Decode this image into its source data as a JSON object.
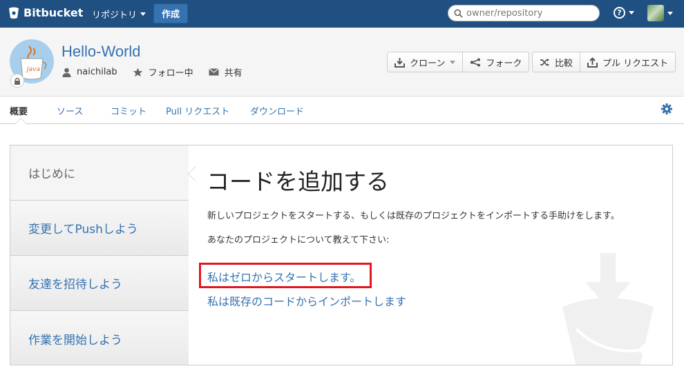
{
  "topbar": {
    "brand": "Bitbucket",
    "repositories_label": "リポジトリ",
    "create_label": "作成",
    "search_placeholder": "owner/repository",
    "help_icon_text": "?"
  },
  "repo": {
    "name": "Hello-World",
    "owner": "naichilab",
    "following_label": "フォロー中",
    "share_label": "共有",
    "avatar_text": "Java",
    "actions": {
      "clone_label": "クローン",
      "fork_label": "フォーク",
      "compare_label": "比較",
      "pull_request_label": "プル リクエスト"
    }
  },
  "tabs": [
    {
      "label": "概要"
    },
    {
      "label": "ソース"
    },
    {
      "label": "コミット"
    },
    {
      "label": "Pull リクエスト"
    },
    {
      "label": "ダウンロード"
    }
  ],
  "steps": [
    {
      "label": "はじめに"
    },
    {
      "label": "変更してPushしよう"
    },
    {
      "label": "友達を招待しよう"
    },
    {
      "label": "作業を開始しよう"
    }
  ],
  "main": {
    "heading": "コードを追加する",
    "description": "新しいプロジェクトをスタートする、もしくは既存のプロジェクトをインポートする手助けをします。",
    "prompt": "あなたのプロジェクトについて教えて下さい:",
    "option_scratch": "私はゼロからスタートします。",
    "option_import": "私は既存のコードからインポートします"
  },
  "colors": {
    "topbar": "#205081",
    "link": "#3572b0",
    "highlight": "#e3161e"
  }
}
